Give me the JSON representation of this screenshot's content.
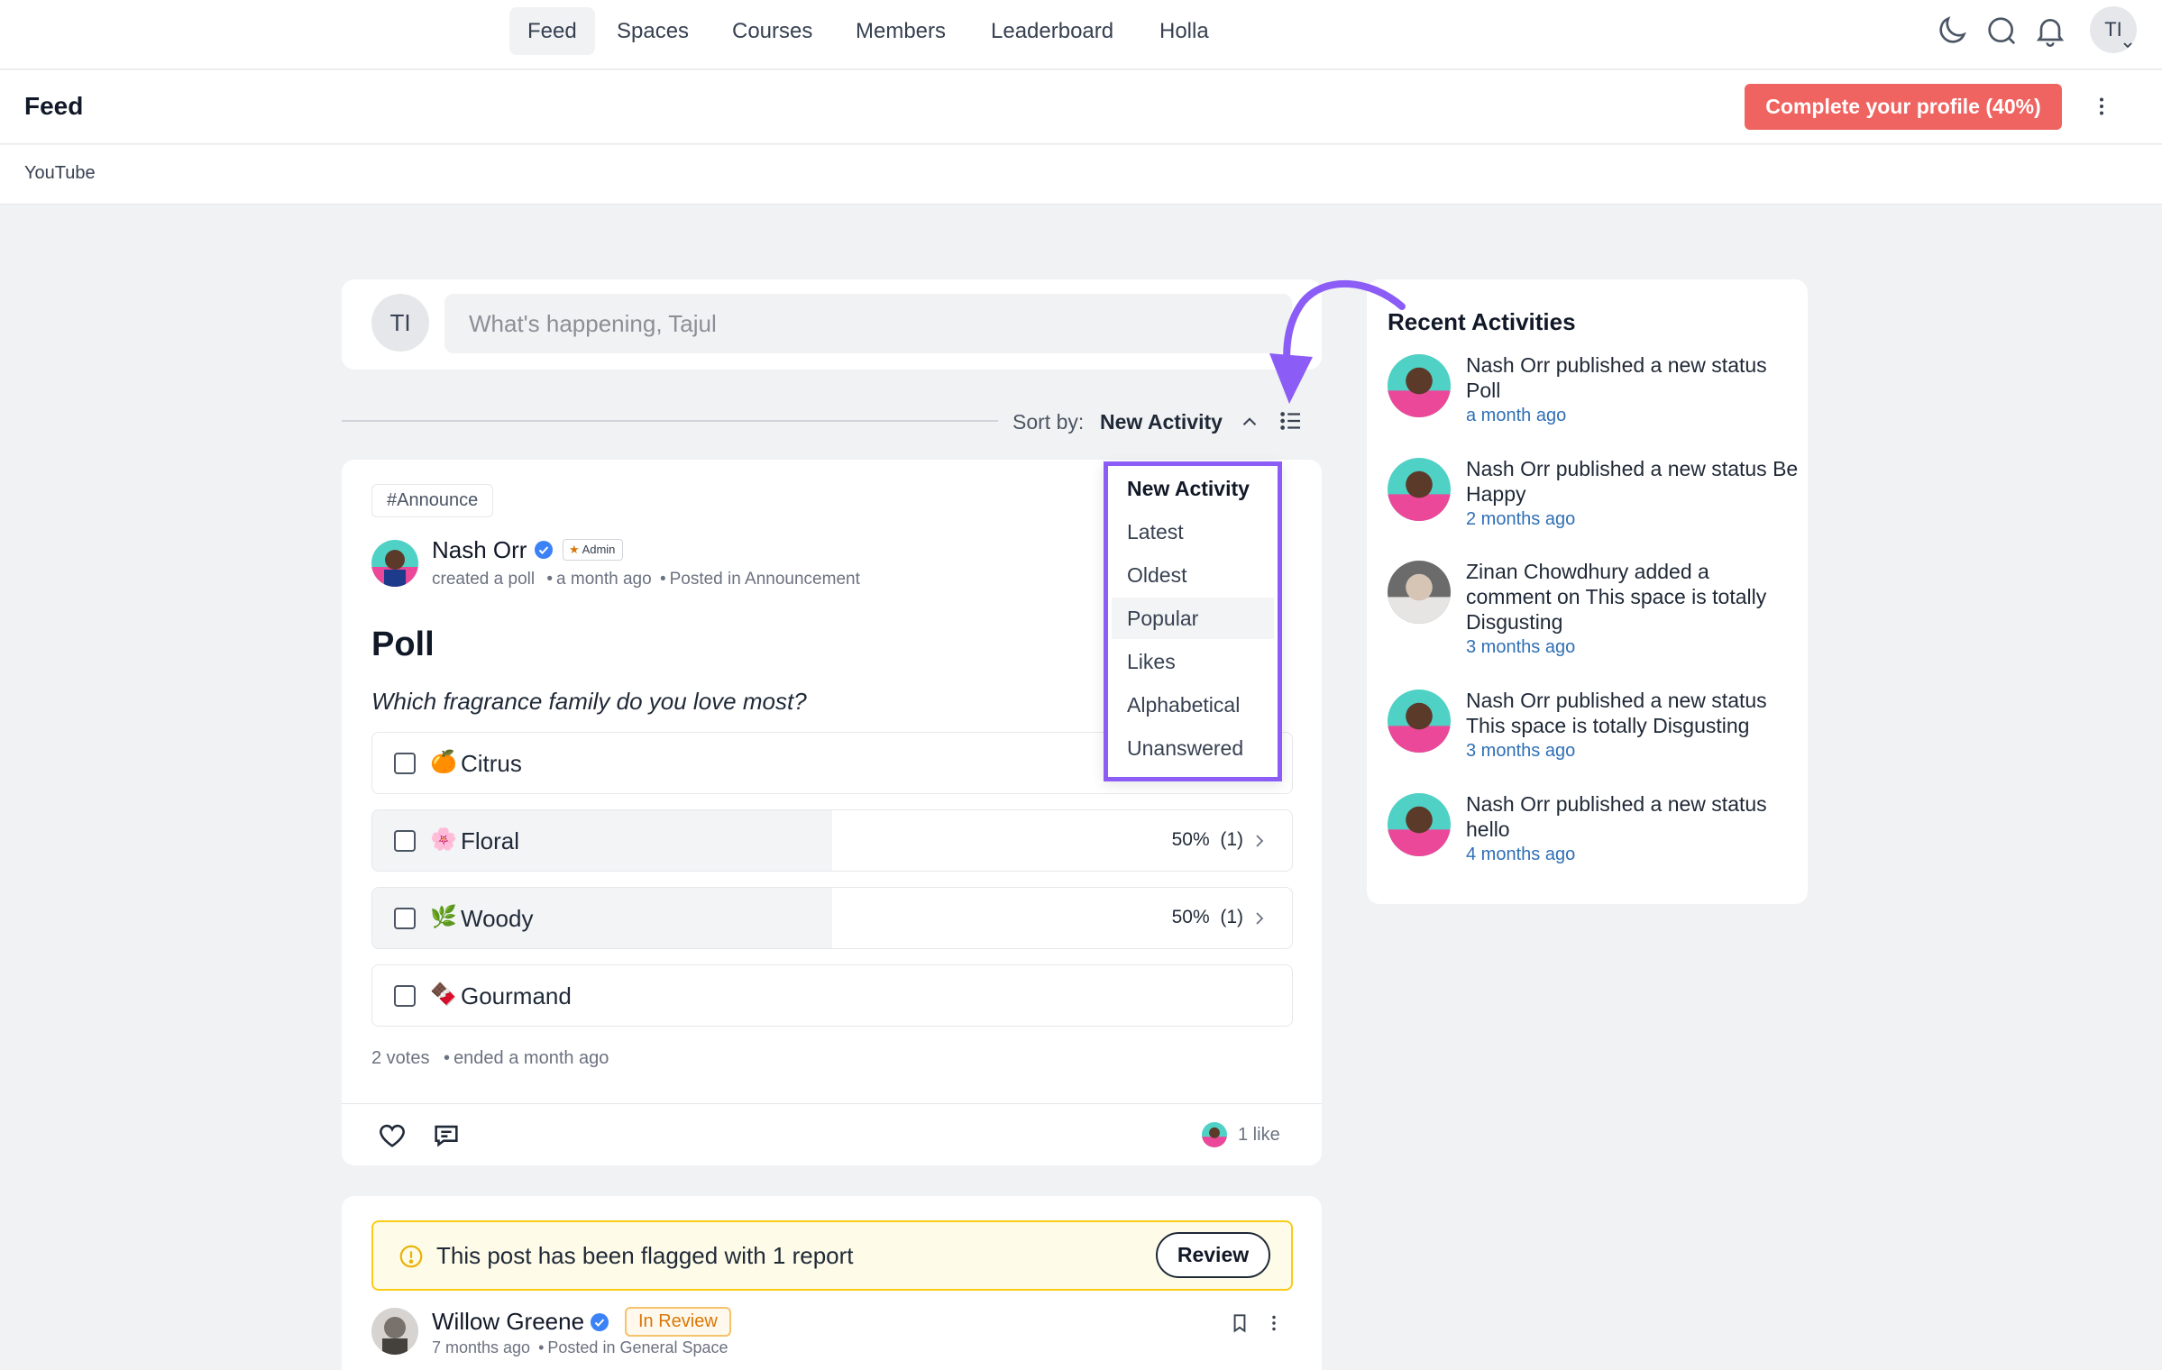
{
  "nav": {
    "items": [
      "Feed",
      "Spaces",
      "Courses",
      "Members",
      "Leaderboard",
      "Holla"
    ],
    "active": "Feed",
    "user_initials": "TI"
  },
  "header": {
    "title": "Feed",
    "profile_button": "Complete your profile (40%)",
    "sub_label": "YouTube"
  },
  "composer": {
    "initials": "TI",
    "placeholder": "What's happening, Tajul"
  },
  "sort": {
    "label": "Sort by:",
    "value": "New Activity",
    "options": [
      "New Activity",
      "Latest",
      "Oldest",
      "Popular",
      "Likes",
      "Alphabetical",
      "Unanswered"
    ],
    "selected_index": 0,
    "hover_index": 3
  },
  "post": {
    "tag": "#Announce",
    "author": "Nash Orr",
    "badge": "Admin",
    "action": "created a poll",
    "time": "a month ago",
    "posted_in": "Posted in Announcement",
    "title": "Poll",
    "question": "Which fragrance family do you love most?",
    "options": [
      {
        "emoji": "🍊",
        "label": "Citrus",
        "percent": "",
        "count": "",
        "fill": 0
      },
      {
        "emoji": "🌸",
        "label": "Floral",
        "percent": "50%",
        "count": "(1)",
        "fill": 0.5
      },
      {
        "emoji": "🌿",
        "label": "Woody",
        "percent": "50%",
        "count": "(1)",
        "fill": 0.5
      },
      {
        "emoji": "🍫",
        "label": "Gourmand",
        "percent": "",
        "count": "",
        "fill": 0
      }
    ],
    "votes": "2 votes",
    "ended": "ended a month ago",
    "likes": "1 like"
  },
  "post2": {
    "flag_text": "This post has been flagged with 1 report",
    "review_button": "Review",
    "author": "Willow Greene",
    "status_badge": "In Review",
    "time": "7 months ago",
    "posted_in": "Posted in General Space"
  },
  "sidebar": {
    "title": "Recent Activities",
    "activities": [
      {
        "name": "Nash Orr",
        "action": "published a new status",
        "target": "Poll",
        "time": "a month ago"
      },
      {
        "name": "Nash Orr",
        "action": "published a new status",
        "target": "Be Happy",
        "time": "2 months ago"
      },
      {
        "name": "Zinan Chowdhury",
        "action": "added a comment on",
        "target": "This space is totally Disgusting",
        "time": "3 months ago"
      },
      {
        "name": "Nash Orr",
        "action": "published a new status",
        "target": "This space is totally Disgusting",
        "time": "3 months ago"
      },
      {
        "name": "Nash Orr",
        "action": "published a new status",
        "target": "hello",
        "time": "4 months ago"
      }
    ]
  },
  "colors": {
    "accent_red": "#ef6461",
    "annotation_purple": "#8b5cf6",
    "link_blue": "#2f6fb6",
    "flag_yellow": "#facc15"
  }
}
